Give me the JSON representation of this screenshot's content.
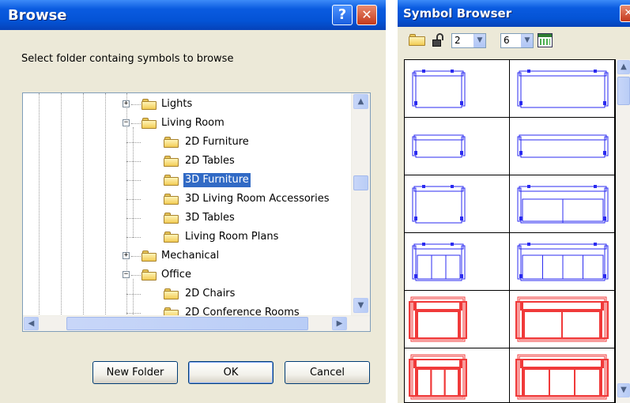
{
  "browse": {
    "title": "Browse",
    "help_glyph": "?",
    "close_glyph": "✕",
    "instruction": "Select folder containg symbols to browse",
    "tree": [
      {
        "label": "Lights",
        "expander": "+",
        "level": 2,
        "selected": false
      },
      {
        "label": "Living Room",
        "expander": "−",
        "level": 2,
        "selected": false
      },
      {
        "label": "2D Furniture",
        "expander": "",
        "level": 3,
        "selected": false
      },
      {
        "label": "2D Tables",
        "expander": "",
        "level": 3,
        "selected": false
      },
      {
        "label": "3D Furniture",
        "expander": "",
        "level": 3,
        "selected": true
      },
      {
        "label": "3D Living Room Accessories",
        "expander": "",
        "level": 3,
        "selected": false
      },
      {
        "label": "3D Tables",
        "expander": "",
        "level": 3,
        "selected": false
      },
      {
        "label": "Living Room Plans",
        "expander": "",
        "level": 3,
        "selected": false
      },
      {
        "label": "Mechanical",
        "expander": "+",
        "level": 2,
        "selected": false
      },
      {
        "label": "Office",
        "expander": "−",
        "level": 2,
        "selected": false
      },
      {
        "label": "2D Chairs",
        "expander": "",
        "level": 3,
        "selected": false
      },
      {
        "label": "2D Conference Rooms",
        "expander": "",
        "level": 3,
        "selected": false
      }
    ],
    "scroll_up": "▲",
    "scroll_down": "▼",
    "scroll_left": "◀",
    "scroll_right": "▶",
    "buttons": {
      "new_folder": "New Folder",
      "ok": "OK",
      "cancel": "Cancel"
    }
  },
  "symbol_browser": {
    "title": "Symbol Browser",
    "close_glyph": "✕",
    "columns_value": "2",
    "rows_value": "6",
    "dropdown_glyph": "▼",
    "scroll_up": "▲",
    "scroll_down": "▼",
    "symbols": [
      {
        "kind": "armchair",
        "color": "#2B2BF0"
      },
      {
        "kind": "sofa",
        "color": "#2B2BF0"
      },
      {
        "kind": "bench-long",
        "color": "#2B2BF0"
      },
      {
        "kind": "bench-short",
        "color": "#2B2BF0"
      },
      {
        "kind": "armchair-tall",
        "color": "#2B2BF0"
      },
      {
        "kind": "loveseat",
        "color": "#2B2BF0"
      },
      {
        "kind": "sofa-3",
        "color": "#2B2BF0"
      },
      {
        "kind": "sofa-4",
        "color": "#2B2BF0"
      },
      {
        "kind": "red-armchair",
        "color": "#F03A3A"
      },
      {
        "kind": "red-loveseat",
        "color": "#F03A3A"
      },
      {
        "kind": "red-sofa",
        "color": "#F03A3A"
      },
      {
        "kind": "red-sofa-3",
        "color": "#F03A3A"
      }
    ]
  }
}
